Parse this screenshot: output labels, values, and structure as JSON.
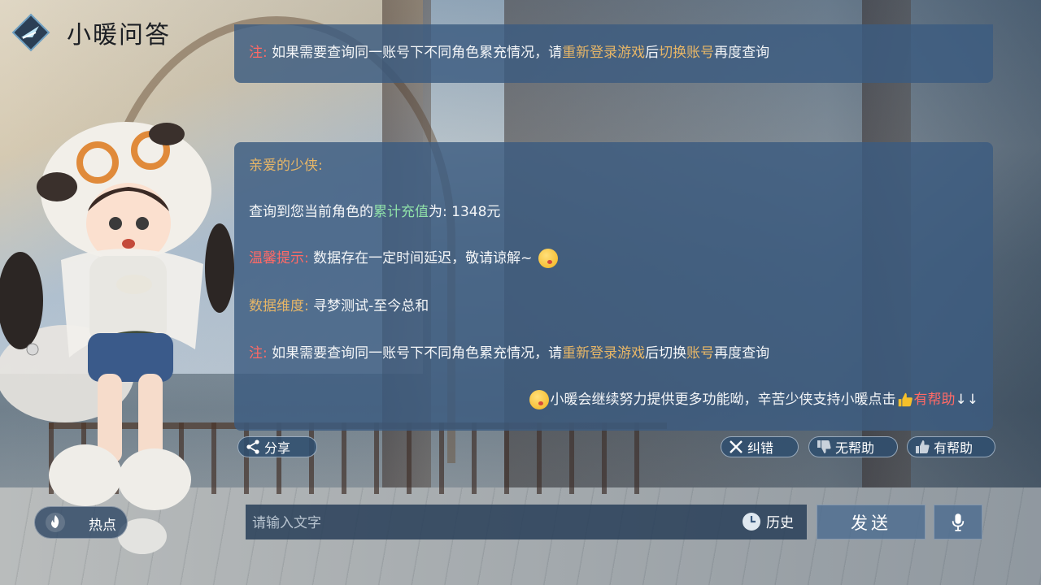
{
  "header": {
    "title": "小暖问答"
  },
  "top_panel": {
    "note_prefix": "注:",
    "note_text_1": "如果需要查询同一账号下不同角色累充情况，请",
    "note_link_1": "重新登录游戏",
    "note_text_2": "后",
    "note_link_2": "切换账号",
    "note_text_3": "再度查询"
  },
  "message": {
    "greeting": "亲爱的少侠:",
    "query_text_1": "查询到您当前角色的",
    "query_highlight": "累计充值",
    "query_text_2": "为: 1348元",
    "tip_label": "温馨提示:",
    "tip_text": "数据存在一定时间延迟，敬请谅解~",
    "dimension_label": "数据维度:",
    "dimension_text": "寻梦测试-至今总和",
    "note_prefix": "注:",
    "note_text_1": "如果需要查询同一账号下不同角色累充情况，请",
    "note_link_1": "重新登录游戏",
    "note_text_2": "后切换",
    "note_link_2": "账号",
    "note_text_3": "再度查询",
    "footer_text": "小暖会继续努力提供更多功能呦，辛苦少侠支持小暖点击",
    "footer_highlight": "有帮助",
    "footer_arrows": "↓↓"
  },
  "actions": {
    "share": "分享",
    "correct": "纠错",
    "not_helpful": "无帮助",
    "helpful": "有帮助"
  },
  "bottom_bar": {
    "hot_label": "热点",
    "input_placeholder": "请输入文字",
    "history_label": "历史",
    "send_label": "发送"
  },
  "colors": {
    "panel": "#3c5c80",
    "red": "#ff6a66",
    "gold": "#e7b667",
    "green": "#8fe0a8"
  },
  "icons": [
    "app-logo-icon",
    "emoji-kiss-icon",
    "thumbs-up-emoji-icon",
    "share-icon",
    "close-icon",
    "thumbs-down-icon",
    "thumbs-up-icon",
    "fire-icon",
    "clock-icon",
    "microphone-icon"
  ]
}
